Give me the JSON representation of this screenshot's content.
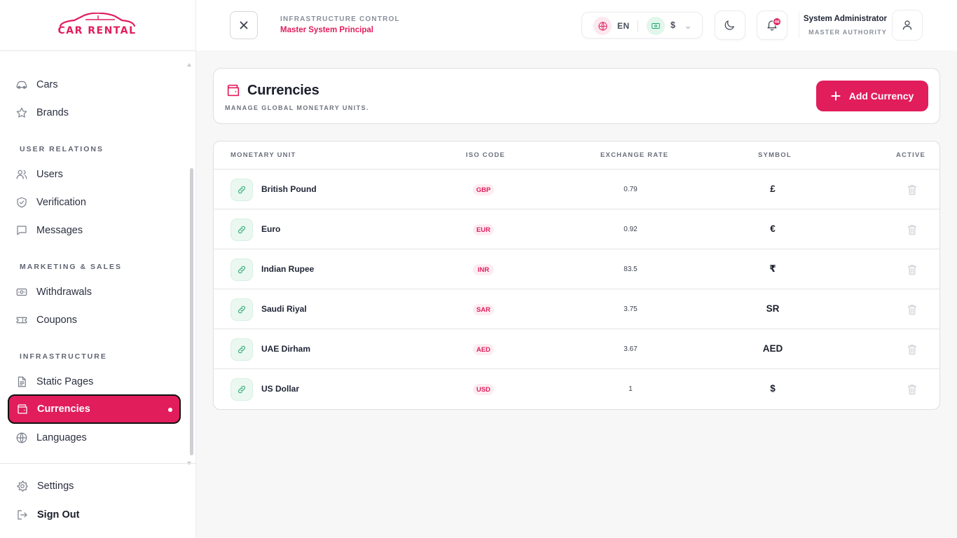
{
  "brand": {
    "logo_text": "CAR RENTAL",
    "accent": "#e11d5c"
  },
  "sidebar": {
    "items": [
      {
        "label": "Cars",
        "icon": "car-icon"
      },
      {
        "label": "Brands",
        "icon": "star-icon"
      }
    ],
    "sections": [
      {
        "title": "USER RELATIONS",
        "items": [
          {
            "label": "Users",
            "icon": "users-icon"
          },
          {
            "label": "Verification",
            "icon": "shield-check-icon"
          },
          {
            "label": "Messages",
            "icon": "message-icon"
          }
        ]
      },
      {
        "title": "MARKETING & SALES",
        "items": [
          {
            "label": "Withdrawals",
            "icon": "banknote-icon"
          },
          {
            "label": "Coupons",
            "icon": "ticket-icon"
          }
        ]
      },
      {
        "title": "INFRASTRUCTURE",
        "items": [
          {
            "label": "Static Pages",
            "icon": "file-text-icon"
          },
          {
            "label": "Currencies",
            "icon": "wallet-icon",
            "active": true
          },
          {
            "label": "Languages",
            "icon": "globe-icon"
          }
        ]
      }
    ],
    "bottom": {
      "settings": "Settings",
      "sign_out": "Sign Out"
    }
  },
  "topbar": {
    "kicker": "INFRASTRUCTURE CONTROL",
    "title": "Master System Principal",
    "language": "EN",
    "currency": "$",
    "notifications_count": "46",
    "user_name": "System Administrator",
    "user_role": "MASTER AUTHORITY"
  },
  "page": {
    "title": "Currencies",
    "subtitle": "MANAGE GLOBAL MONETARY UNITS.",
    "add_button": "Add Currency"
  },
  "table": {
    "columns": [
      "MONETARY UNIT",
      "ISO CODE",
      "EXCHANGE RATE",
      "SYMBOL",
      "ACTIVE"
    ],
    "rows": [
      {
        "name": "British Pound",
        "iso": "GBP",
        "rate": "0.79",
        "symbol": "£"
      },
      {
        "name": "Euro",
        "iso": "EUR",
        "rate": "0.92",
        "symbol": "€"
      },
      {
        "name": "Indian Rupee",
        "iso": "INR",
        "rate": "83.5",
        "symbol": "₹"
      },
      {
        "name": "Saudi Riyal",
        "iso": "SAR",
        "rate": "3.75",
        "symbol": "SR"
      },
      {
        "name": "UAE Dirham",
        "iso": "AED",
        "rate": "3.67",
        "symbol": "AED"
      },
      {
        "name": "US Dollar",
        "iso": "USD",
        "rate": "1",
        "symbol": "$"
      }
    ]
  }
}
